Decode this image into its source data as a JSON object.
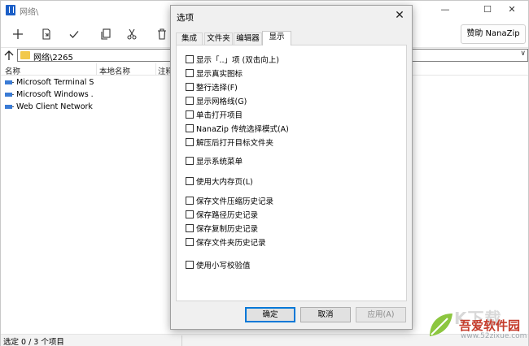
{
  "window": {
    "title": "网络\\",
    "minimize": "—",
    "maximize": "☐",
    "close": "✕"
  },
  "toolbar": {
    "buttons": [
      {
        "icon": "add-icon"
      },
      {
        "icon": "extract-icon"
      },
      {
        "icon": "test-check-icon"
      },
      {
        "icon": "copy-icon"
      },
      {
        "icon": "cut-move-icon"
      },
      {
        "icon": "delete-icon"
      }
    ],
    "sponsor_label": "赞助 NanaZip"
  },
  "address": {
    "path": "网络\\2265",
    "dropdown": "∨"
  },
  "list": {
    "columns": [
      "名称",
      "本地名称",
      "注释"
    ],
    "rows": [
      {
        "name": "Microsoft Terminal S...",
        "icon": "network-share-icon"
      },
      {
        "name": "Microsoft Windows ...",
        "icon": "network-share-icon"
      },
      {
        "name": "Web Client Network",
        "icon": "network-share-icon"
      }
    ]
  },
  "status": {
    "text": "选定 0 / 3 个项目"
  },
  "dialog": {
    "title": "选项",
    "close": "✕",
    "tabs": [
      "集成",
      "文件夹",
      "编辑器",
      "显示"
    ],
    "active_tab": "显示",
    "options": [
      {
        "label": "显示「..」项 (双击向上)",
        "checked": false
      },
      {
        "label": "显示真实图标",
        "checked": false
      },
      {
        "label": "整行选择(F)",
        "checked": false
      },
      {
        "label": "显示网格线(G)",
        "checked": false
      },
      {
        "label": "单击打开项目",
        "checked": false
      },
      {
        "label": "NanaZip 传统选择模式(A)",
        "checked": false
      },
      {
        "label": "解压后打开目标文件夹",
        "checked": false
      },
      {
        "label": "显示系统菜单",
        "checked": false
      },
      {
        "label": "使用大内存页(L)",
        "checked": false
      },
      {
        "label": "保存文件压缩历史记录",
        "checked": false
      },
      {
        "label": "保存路径历史记录",
        "checked": false
      },
      {
        "label": "保存复制历史记录",
        "checked": false
      },
      {
        "label": "保存文件夹历史记录",
        "checked": false
      },
      {
        "label": "使用小写校验值",
        "checked": false
      }
    ],
    "buttons": {
      "ok": "确定",
      "cancel": "取消",
      "apply": "应用(A)"
    }
  },
  "watermark": {
    "big": "K下载",
    "name": "吾爱软件园",
    "url": "www.52zixue.com"
  }
}
